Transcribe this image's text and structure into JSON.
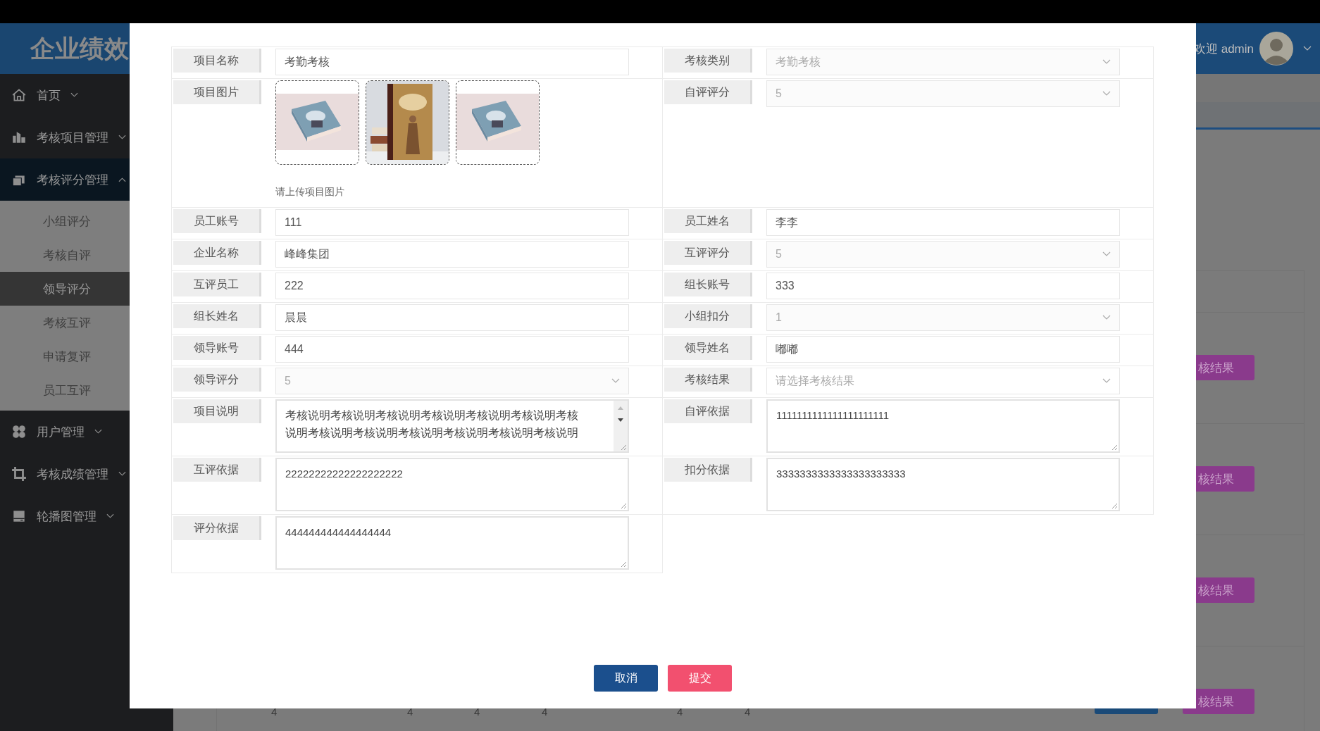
{
  "header": {
    "logo": "企业绩效",
    "welcome": "欢迎 admin"
  },
  "sidebar": {
    "items": [
      {
        "label": "首页",
        "expanded": false
      },
      {
        "label": "考核项目管理",
        "expanded": false
      },
      {
        "label": "考核评分管理",
        "expanded": true,
        "children": [
          {
            "label": "小组评分",
            "selected": false
          },
          {
            "label": "考核自评",
            "selected": false
          },
          {
            "label": "领导评分",
            "selected": true
          },
          {
            "label": "考核互评",
            "selected": false
          },
          {
            "label": "申请复评",
            "selected": false
          },
          {
            "label": "员工互评",
            "selected": false
          }
        ]
      },
      {
        "label": "用户管理",
        "expanded": false
      },
      {
        "label": "考核成绩管理",
        "expanded": false
      },
      {
        "label": "轮播图管理",
        "expanded": false
      }
    ]
  },
  "background_table": {
    "rows": [
      {
        "action": "核结果"
      },
      {
        "action": "核结果"
      },
      {
        "action": "核结果"
      },
      {
        "action": "核结果",
        "cells": [
          "4",
          "4",
          "4",
          "4",
          "4",
          "4"
        ]
      }
    ]
  },
  "form": {
    "rows": [
      {
        "left": {
          "label": "项目名称",
          "kind": "input",
          "value": "考勤考核"
        },
        "right": {
          "label": "考核类别",
          "kind": "select",
          "disabled": true,
          "value": "考勤考核"
        }
      },
      {
        "left": {
          "label": "项目图片",
          "kind": "images",
          "hint": "请上传项目图片"
        },
        "right": {
          "label": "自评评分",
          "kind": "select",
          "disabled": true,
          "value": "5"
        }
      },
      {
        "left": {
          "label": "员工账号",
          "kind": "input",
          "value": "111"
        },
        "right": {
          "label": "员工姓名",
          "kind": "input",
          "value": "李李"
        }
      },
      {
        "left": {
          "label": "企业名称",
          "kind": "input",
          "value": "峰峰集团"
        },
        "right": {
          "label": "互评评分",
          "kind": "select",
          "disabled": true,
          "value": "5"
        }
      },
      {
        "left": {
          "label": "互评员工",
          "kind": "input",
          "value": "222"
        },
        "right": {
          "label": "组长账号",
          "kind": "input",
          "value": "333"
        }
      },
      {
        "left": {
          "label": "组长姓名",
          "kind": "input",
          "value": "晨晨"
        },
        "right": {
          "label": "小组扣分",
          "kind": "select",
          "disabled": true,
          "value": "1"
        }
      },
      {
        "left": {
          "label": "领导账号",
          "kind": "input",
          "value": "444"
        },
        "right": {
          "label": "领导姓名",
          "kind": "input",
          "value": "嘟嘟"
        }
      },
      {
        "left": {
          "label": "领导评分",
          "kind": "select",
          "disabled": true,
          "value": "5"
        },
        "right": {
          "label": "考核结果",
          "kind": "select",
          "placeholder": "请选择考核结果"
        }
      },
      {
        "left": {
          "label": "项目说明",
          "kind": "textarea",
          "scroll": true,
          "value": "考核说明考核说明考核说明考核说明考核说明考核说明考核说明考核说明考核说明考核说明考核说明考核说明考核说明"
        },
        "right": {
          "label": "自评依据",
          "kind": "textarea",
          "value": "1111111111111111111111"
        }
      },
      {
        "left": {
          "label": "互评依据",
          "kind": "textarea",
          "value": "22222222222222222222"
        },
        "right": {
          "label": "扣分依据",
          "kind": "textarea",
          "value": "3333333333333333333333"
        }
      },
      {
        "left": {
          "label": "评分依据",
          "kind": "textarea",
          "value": "444444444444444444"
        }
      }
    ]
  },
  "buttons": [
    {
      "label": "取消",
      "kind": "cancel"
    },
    {
      "label": "提交",
      "kind": "submit"
    }
  ]
}
